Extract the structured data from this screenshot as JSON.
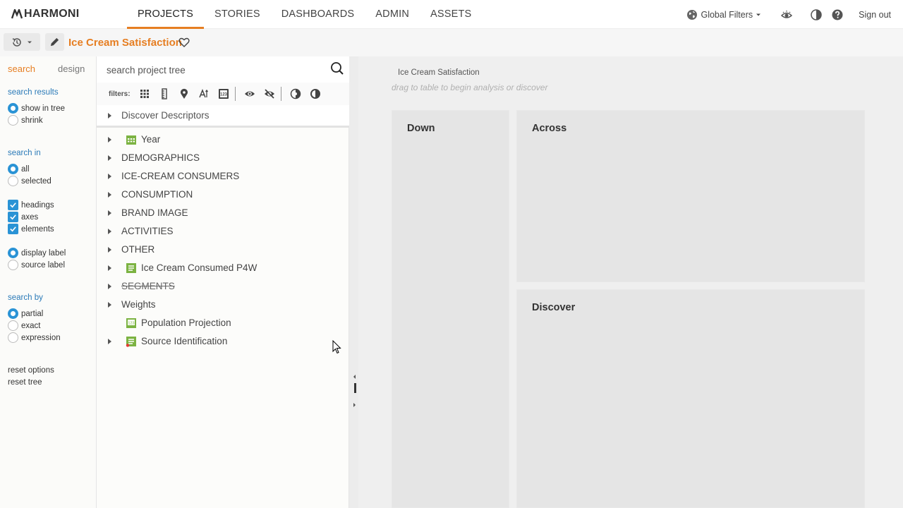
{
  "app": {
    "logo_text": "HARMONI"
  },
  "nav": {
    "items": [
      {
        "label": "PROJECTS",
        "active": true
      },
      {
        "label": "STORIES",
        "active": false
      },
      {
        "label": "DASHBOARDS",
        "active": false
      },
      {
        "label": "ADMIN",
        "active": false
      },
      {
        "label": "ASSETS",
        "active": false
      }
    ]
  },
  "toolbar": {
    "global_filters": "Global Filters",
    "sign_out": "Sign out"
  },
  "project": {
    "title": "Ice Cream Satisfaction"
  },
  "left_panel": {
    "tabs": [
      {
        "label": "search",
        "active": true
      },
      {
        "label": "design",
        "active": false
      }
    ],
    "search_results": {
      "title": "search results",
      "options": [
        "show in tree",
        "shrink"
      ],
      "selected": "show in tree"
    },
    "search_in": {
      "title": "search in",
      "options": [
        "all",
        "selected"
      ],
      "selected": "all"
    },
    "checks": [
      "headings",
      "axes",
      "elements"
    ],
    "label_mode": {
      "options": [
        "display label",
        "source label"
      ],
      "selected": "display label"
    },
    "search_by": {
      "title": "search by",
      "options": [
        "partial",
        "exact",
        "expression"
      ],
      "selected": "partial"
    },
    "links": [
      "reset options",
      "reset tree"
    ]
  },
  "tree": {
    "search_placeholder": "search project tree",
    "filters_label": "filters:",
    "discover_label": "Discover Descriptors",
    "items": [
      {
        "label": "Year",
        "icon": "calendar-icon",
        "expandable": true
      },
      {
        "label": "DEMOGRAPHICS",
        "icon": null,
        "expandable": true
      },
      {
        "label": "ICE-CREAM CONSUMERS",
        "icon": null,
        "expandable": true
      },
      {
        "label": "CONSUMPTION",
        "icon": null,
        "expandable": true
      },
      {
        "label": "BRAND IMAGE",
        "icon": null,
        "expandable": true
      },
      {
        "label": "ACTIVITIES",
        "icon": null,
        "expandable": true
      },
      {
        "label": "OTHER",
        "icon": null,
        "expandable": true
      },
      {
        "label": "Ice Cream Consumed P4W",
        "icon": "list-variable-icon",
        "expandable": true
      },
      {
        "label": "SEGMENTS",
        "icon": null,
        "expandable": true,
        "strikethrough": true
      },
      {
        "label": "Weights",
        "icon": null,
        "expandable": true
      },
      {
        "label": "Population Projection",
        "icon": "numeric-variable-icon",
        "expandable": false
      },
      {
        "label": "Source Identification",
        "icon": "list-variable-icon",
        "expandable": true
      }
    ]
  },
  "canvas": {
    "title": "Ice Cream Satisfaction",
    "hint": "drag to table to begin analysis or discover",
    "zones": {
      "down": "Down",
      "across": "Across",
      "discover": "Discover"
    }
  },
  "colors": {
    "accent": "#e67e22",
    "link": "#2a7ab8",
    "control": "#2a93d5",
    "icon_green": "#7cb342"
  }
}
